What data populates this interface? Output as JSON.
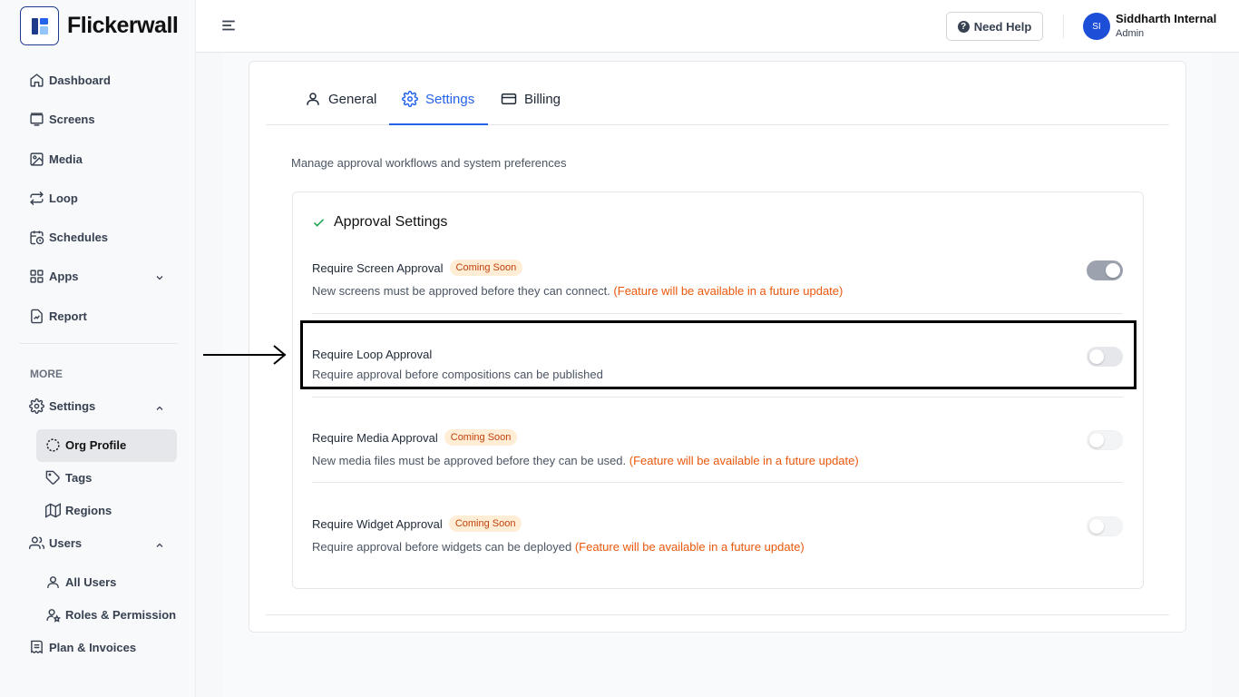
{
  "app": {
    "name": "Flickerwall"
  },
  "sidebar": {
    "items": [
      {
        "label": "Dashboard"
      },
      {
        "label": "Screens"
      },
      {
        "label": "Media"
      },
      {
        "label": "Loop"
      },
      {
        "label": "Schedules"
      },
      {
        "label": "Apps"
      },
      {
        "label": "Report"
      }
    ],
    "more_label": "MORE",
    "settings": {
      "label": "Settings",
      "children": [
        {
          "label": "Org Profile"
        },
        {
          "label": "Tags"
        },
        {
          "label": "Regions"
        }
      ]
    },
    "users": {
      "label": "Users",
      "children": [
        {
          "label": "All Users"
        },
        {
          "label": "Roles & Permission"
        }
      ]
    },
    "plan": {
      "label": "Plan & Invoices"
    }
  },
  "header": {
    "help_label": "Need Help",
    "user": {
      "initials": "SI",
      "name": "Siddharth Internal",
      "role": "Admin"
    }
  },
  "tabs": [
    {
      "label": "General",
      "active": false
    },
    {
      "label": "Settings",
      "active": true
    },
    {
      "label": "Billing",
      "active": false
    }
  ],
  "page": {
    "description": "Manage approval workflows and system preferences",
    "section_title": "Approval Settings",
    "settings": [
      {
        "title": "Require Screen Approval",
        "badge": "Coming Soon",
        "description": "New screens must be approved before they can connect.",
        "note": "(Feature will be available in a future update)",
        "enabled": true
      },
      {
        "title": "Require Loop Approval",
        "badge": "",
        "description": "Require approval before compositions can be published",
        "note": "",
        "enabled": false
      },
      {
        "title": "Require Media Approval",
        "badge": "Coming Soon",
        "description": "New media files must be approved before they can be used.",
        "note": "(Feature will be available in a future update)",
        "enabled": false
      },
      {
        "title": "Require Widget Approval",
        "badge": "Coming Soon",
        "description": "Require approval before widgets can be deployed",
        "note": "(Feature will be available in a future update)",
        "enabled": false
      }
    ]
  },
  "colors": {
    "accent": "#2563eb",
    "warning": "#ea580c",
    "badge_bg": "#ffedd5"
  }
}
